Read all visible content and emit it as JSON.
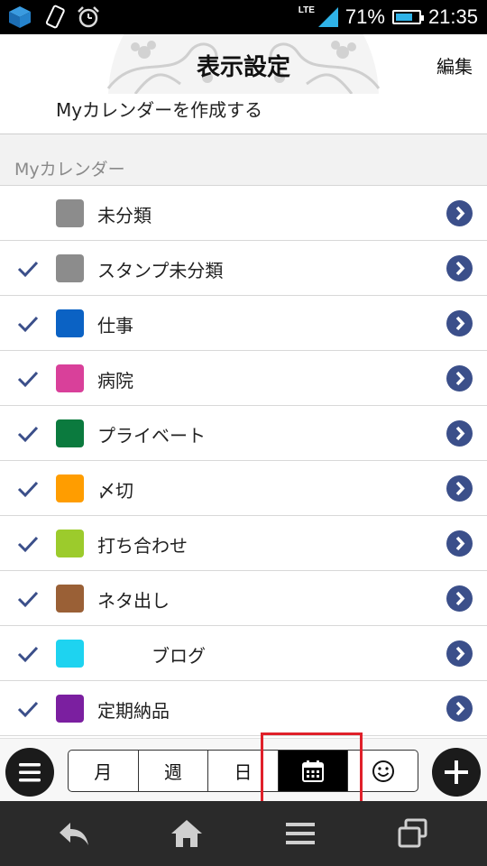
{
  "status_bar": {
    "network_label": "LTE",
    "battery_percent": "71%",
    "battery_level": 0.71,
    "time": "21:35",
    "icons": [
      "app-box-icon",
      "phone-rotate-icon",
      "alarm-clock-icon",
      "signal-icon",
      "battery-icon"
    ]
  },
  "header": {
    "title": "表示設定",
    "edit_label": "編集"
  },
  "create_row": {
    "label": "Myカレンダーを作成する"
  },
  "section": {
    "label": "Myカレンダー"
  },
  "calendars": [
    {
      "name": "未分類",
      "color": "#8c8c8c",
      "checked": false
    },
    {
      "name": "スタンプ未分類",
      "color": "#8c8c8c",
      "checked": true
    },
    {
      "name": "仕事",
      "color": "#0b62c4",
      "checked": true
    },
    {
      "name": "病院",
      "color": "#d9409a",
      "checked": true
    },
    {
      "name": "プライベート",
      "color": "#0b7a3e",
      "checked": true
    },
    {
      "name": "〆切",
      "color": "#ff9d00",
      "checked": true
    },
    {
      "name": "打ち合わせ",
      "color": "#9ccb2c",
      "checked": true
    },
    {
      "name": "ネタ出し",
      "color": "#9a6036",
      "checked": true
    },
    {
      "name": "　　　ブログ",
      "color": "#1ed3f0",
      "checked": true
    },
    {
      "name": "定期納品",
      "color": "#7b1fa0",
      "checked": true
    }
  ],
  "toolbar": {
    "tabs": [
      "月",
      "週",
      "日",
      "",
      ""
    ],
    "active_tab_index": 3,
    "tab_icons": [
      "",
      "",
      "",
      "calendar-icon",
      "smiley-icon"
    ]
  },
  "colors": {
    "accent": "#3b4f8a",
    "highlight_box": "#e0202a",
    "status_bar_bg": "#000000",
    "nav_bar_bg": "#2a2a2a"
  }
}
